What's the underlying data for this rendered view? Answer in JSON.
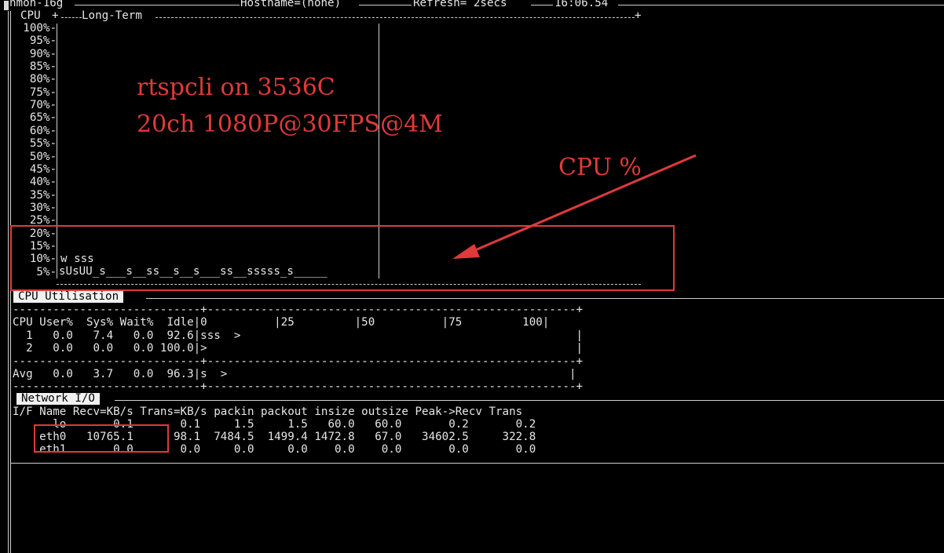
{
  "header": {
    "app": "nmon-16g",
    "hostname": "Hostname=(none)",
    "refresh": "Refresh= 2secs",
    "clock": "16:06.54"
  },
  "long_term": {
    "title": "CPU",
    "graph_label": "Long-Term",
    "y_labels": [
      "100%-",
      "95%-",
      "90%-",
      "85%-",
      "80%-",
      "75%-",
      "70%-",
      "65%-",
      "60%-",
      "55%-",
      "50%-",
      "45%-",
      "40%-",
      "35%-",
      "30%-",
      "25%-",
      "20%-",
      "15%-",
      "10%-",
      "5%-"
    ],
    "row_10": "w sss",
    "row_5": "sUsUU_s___s__ss__s__s___ss__sssss_s_____"
  },
  "annotations": {
    "line1": "rtspcli on 3536C",
    "line2": "20ch 1080P@30FPS@4M",
    "cpu_label": "CPU %",
    "accent": "#e03a3a"
  },
  "cpu_util": {
    "label": "CPU Utilisation",
    "header": "CPU User%  Sys% Wait%  Idle|0          |25         |50          |75         100|",
    "rows": [
      "  1   0.0   7.4   0.0  92.6|sss  >                                                  |",
      "  2   0.0   0.0   0.0 100.0|>                                                       |"
    ],
    "avg": "Avg   0.0   3.7   0.0  96.3|s  >                                                   |",
    "sep": "----------------------------+-------------------------------------------------------+"
  },
  "network": {
    "label": "Network I/O",
    "header": "I/F Name Recv=KB/s Trans=KB/s packin packout insize outsize Peak->Recv Trans",
    "rows": [
      "      lo       0.1       0.1     1.5     1.5   60.0   60.0       0.2       0.2",
      "    eth0   10765.1      98.1  7484.5  1499.4 1472.8   67.0   34602.5     322.8",
      "    eth1       0.0       0.0     0.0     0.0    0.0    0.0       0.0       0.0"
    ]
  }
}
